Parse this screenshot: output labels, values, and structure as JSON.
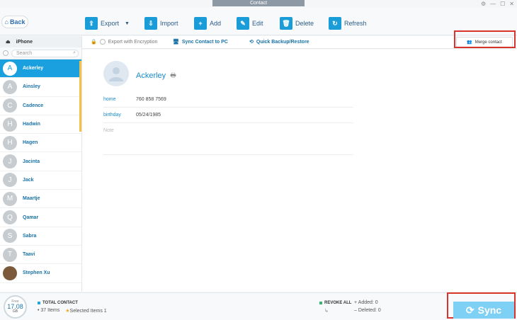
{
  "window": {
    "title": "Contact"
  },
  "toolbar": {
    "back_label": "Back",
    "export_label": "Export",
    "import_label": "Import",
    "add_label": "Add",
    "edit_label": "Edit",
    "delete_label": "Delete",
    "refresh_label": "Refresh"
  },
  "device": {
    "name": "iPhone"
  },
  "search": {
    "placeholder": "Search"
  },
  "contacts": [
    {
      "initial": "A",
      "name": "Ackerley"
    },
    {
      "initial": "A",
      "name": "Ainsley"
    },
    {
      "initial": "C",
      "name": "Cadence"
    },
    {
      "initial": "H",
      "name": "Hadwin"
    },
    {
      "initial": "H",
      "name": "Hagen"
    },
    {
      "initial": "J",
      "name": "Jacinta"
    },
    {
      "initial": "J",
      "name": "Jack"
    },
    {
      "initial": "M",
      "name": "Maartje"
    },
    {
      "initial": "Q",
      "name": "Qamar"
    },
    {
      "initial": "S",
      "name": "Sabra"
    },
    {
      "initial": "T",
      "name": "Taavi"
    },
    {
      "initial": "",
      "name": "Stephen Xu"
    }
  ],
  "subbar": {
    "encryption_label": "Export with Encryption",
    "sync_pc_label": "Sync Contact to PC",
    "backup_label": "Quick Backup/Restore",
    "merge_label": "Merge contact"
  },
  "detail": {
    "name": "Ackerley",
    "fields": [
      {
        "label": "home",
        "value": "760 858 7569"
      },
      {
        "label": "birthday",
        "value": "05/24/1985"
      }
    ],
    "note_label": "Note"
  },
  "status": {
    "free_label": "Free",
    "free_value": "17.08",
    "free_unit": "GB",
    "total_label": "TOTAL CONTACT",
    "items_text": "37 Items",
    "selected_text": "Selected Items 1",
    "revoke_label": "REVOKE ALL",
    "added_text": "Added: 0",
    "deleted_text": "Deleted: 0",
    "sync_label": "Sync"
  },
  "colors": {
    "accent": "#1aa0df",
    "highlight_outline": "#d9342b"
  }
}
